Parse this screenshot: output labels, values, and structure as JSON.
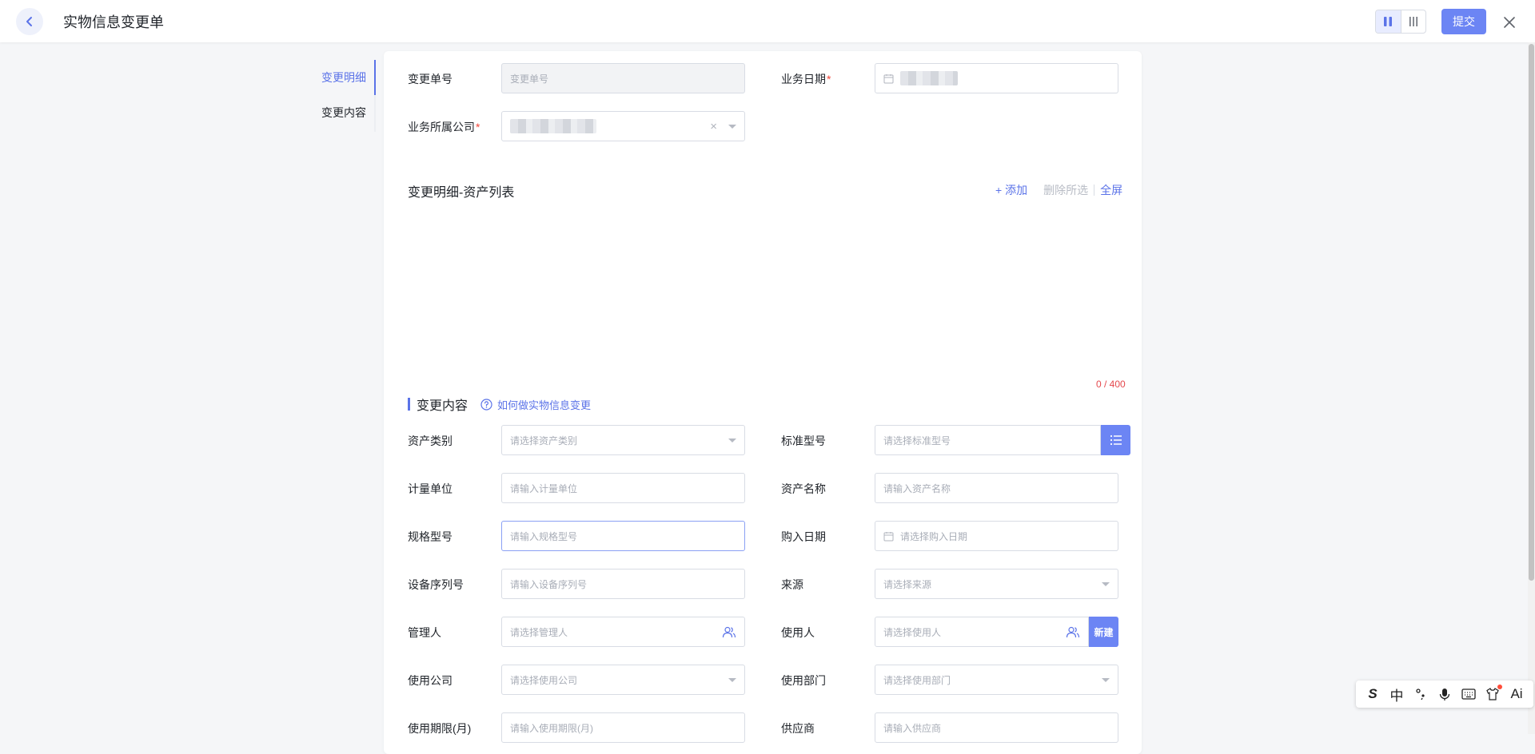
{
  "header": {
    "title": "实物信息变更单",
    "submit_label": "提交"
  },
  "anchor_nav": {
    "items": [
      {
        "label": "变更明细"
      },
      {
        "label": "变更内容"
      }
    ]
  },
  "form_top": {
    "change_no": {
      "label": "变更单号",
      "placeholder": "变更单号"
    },
    "biz_date": {
      "label": "业务日期"
    },
    "company": {
      "label": "业务所属公司"
    },
    "required_mark": "*"
  },
  "asset_list": {
    "title": "变更明细-资产列表",
    "add_label": "+ 添加",
    "delete_label": "删除所选",
    "fullscreen_label": "全屏",
    "counter": "0 / 400"
  },
  "change_content": {
    "title": "变更内容",
    "help_link": "如何做实物信息变更",
    "fields": {
      "asset_category": {
        "label": "资产类别",
        "placeholder": "请选择资产类别"
      },
      "standard_model": {
        "label": "标准型号",
        "placeholder": "请选择标准型号"
      },
      "unit": {
        "label": "计量单位",
        "placeholder": "请输入计量单位"
      },
      "asset_name": {
        "label": "资产名称",
        "placeholder": "请输入资产名称"
      },
      "spec_model": {
        "label": "规格型号",
        "placeholder": "请输入规格型号"
      },
      "purchase_date": {
        "label": "购入日期",
        "placeholder": "请选择购入日期"
      },
      "serial_no": {
        "label": "设备序列号",
        "placeholder": "请输入设备序列号"
      },
      "source": {
        "label": "来源",
        "placeholder": "请选择来源"
      },
      "manager": {
        "label": "管理人",
        "placeholder": "请选择管理人"
      },
      "user": {
        "label": "使用人",
        "placeholder": "请选择使用人",
        "new_label": "新建"
      },
      "use_company": {
        "label": "使用公司",
        "placeholder": "请选择使用公司"
      },
      "use_dept": {
        "label": "使用部门",
        "placeholder": "请选择使用部门"
      },
      "use_period": {
        "label": "使用期限(月)",
        "placeholder": "请输入使用期限(月)"
      },
      "supplier": {
        "label": "供应商",
        "placeholder": "请输入供应商"
      }
    }
  },
  "ime": {
    "logo": "S",
    "mode": "中",
    "ai": "Ai"
  }
}
